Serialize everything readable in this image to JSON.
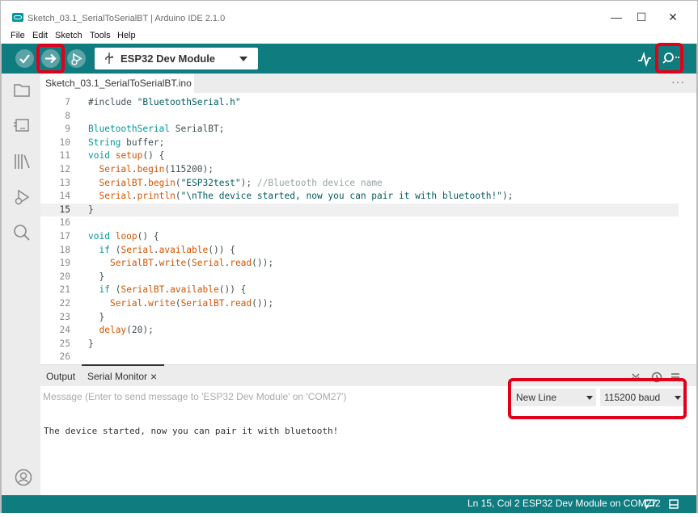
{
  "window": {
    "title": "Sketch_03.1_SerialToSerialBT | Arduino IDE 2.1.0",
    "minimize": "—",
    "maximize": "☐",
    "close": "✕"
  },
  "menu": [
    "File",
    "Edit",
    "Sketch",
    "Tools",
    "Help"
  ],
  "toolbar": {
    "board": "ESP32 Dev Module",
    "icons": [
      "verify-icon",
      "upload-icon",
      "debug-icon",
      "usb-icon",
      "serial-plotter-icon",
      "serial-monitor-icon"
    ],
    "accent_color": "#0f7c80",
    "highlight_color": "#e0001a"
  },
  "sidebar": {
    "icons": [
      "folder-icon",
      "boards-manager-icon",
      "library-manager-icon",
      "debug-icon",
      "search-icon",
      "account-icon"
    ]
  },
  "editor": {
    "file_tab": "Sketch_03.1_SerialToSerialBT.ino",
    "more": "···",
    "current_line": "15",
    "lines": [
      {
        "n": "7",
        "code": "#include \"BluetoothSerial.h\""
      },
      {
        "n": "8",
        "code": ""
      },
      {
        "n": "9",
        "code": "BluetoothSerial SerialBT;"
      },
      {
        "n": "10",
        "code": "String buffer;"
      },
      {
        "n": "11",
        "code": "void setup() {"
      },
      {
        "n": "12",
        "code": "  Serial.begin(115200);"
      },
      {
        "n": "13",
        "code": "  SerialBT.begin(\"ESP32test\"); //Bluetooth device name"
      },
      {
        "n": "14",
        "code": "  Serial.println(\"\\nThe device started, now you can pair it with bluetooth!\");"
      },
      {
        "n": "15",
        "code": "}"
      },
      {
        "n": "16",
        "code": ""
      },
      {
        "n": "17",
        "code": "void loop() {"
      },
      {
        "n": "18",
        "code": "  if (Serial.available()) {"
      },
      {
        "n": "19",
        "code": "    SerialBT.write(Serial.read());"
      },
      {
        "n": "20",
        "code": "  }"
      },
      {
        "n": "21",
        "code": "  if (SerialBT.available()) {"
      },
      {
        "n": "22",
        "code": "    Serial.write(SerialBT.read());"
      },
      {
        "n": "23",
        "code": "  }"
      },
      {
        "n": "24",
        "code": "  delay(20);"
      },
      {
        "n": "25",
        "code": "}"
      },
      {
        "n": "26",
        "code": ""
      }
    ]
  },
  "panel": {
    "tabs": [
      "Output",
      "Serial Monitor"
    ],
    "tab_close": "×",
    "active_tab": "Serial Monitor",
    "message_placeholder": "Message (Enter to send message to 'ESP32 Dev Module' on 'COM27')",
    "line_ending": "New Line",
    "baud_rate": "115200 baud",
    "output": "The device started, now you can pair it with bluetooth!"
  },
  "status": {
    "position": "Ln 15, Col 2",
    "board_port": "ESP32 Dev Module on COM27",
    "notifications": "2"
  }
}
